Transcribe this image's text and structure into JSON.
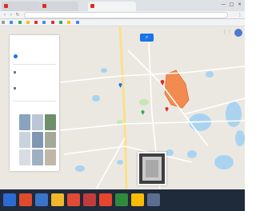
{
  "browser": {
    "tabs": [
      {
        "label": "",
        "active": false,
        "color": "#d93025"
      },
      {
        "label": "",
        "active": false,
        "color": "#d93025"
      },
      {
        "label": "",
        "active": true,
        "color": "#d93025"
      }
    ],
    "window_controls": [
      "—",
      "□",
      "×"
    ],
    "address": "",
    "bookmarks": [
      "",
      "",
      "",
      "",
      "",
      "",
      "",
      "",
      "",
      "",
      "",
      ""
    ]
  },
  "map": {
    "search_icon": "search-icon",
    "panel": {
      "title": "",
      "subtitle": "",
      "route_label": "",
      "details": [
        "",
        ""
      ],
      "link": "",
      "photos_label": ""
    },
    "labels": [],
    "footer": ""
  },
  "taskbar": {
    "clock": ""
  },
  "colors": {
    "map_bg": "#ebe8e2",
    "water": "#aad3f0",
    "park": "#c8e6b0",
    "road": "#fbe08a",
    "highlight": "#f28b50",
    "accent": "#1a73e8",
    "taskbar": "#1f2a3a"
  }
}
